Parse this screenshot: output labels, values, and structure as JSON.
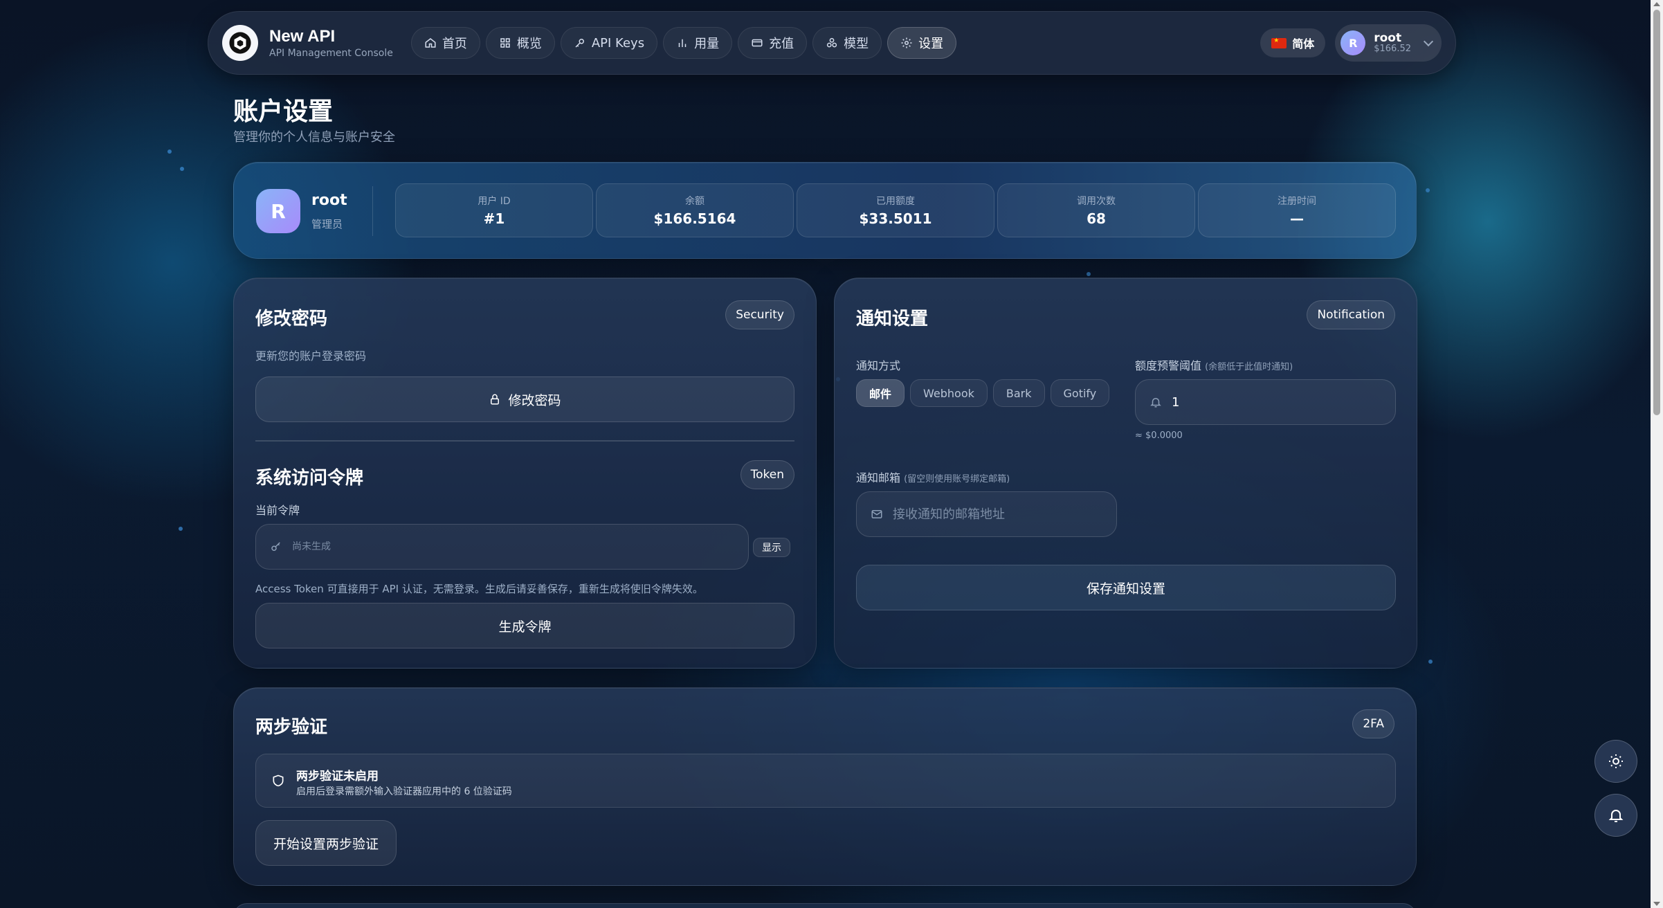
{
  "nav": {
    "brand_name": "New API",
    "brand_sub": "API Management Console",
    "items": [
      {
        "label": "首页",
        "icon": "home-icon"
      },
      {
        "label": "概览",
        "icon": "grid-icon"
      },
      {
        "label": "API Keys",
        "icon": "key-icon"
      },
      {
        "label": "用量",
        "icon": "bar-chart-icon"
      },
      {
        "label": "充值",
        "icon": "credit-card-icon"
      },
      {
        "label": "模型",
        "icon": "models-icon"
      },
      {
        "label": "设置",
        "icon": "gear-icon",
        "active": true
      }
    ],
    "language": "简体",
    "user": {
      "initial": "R",
      "name": "root",
      "balance": "$166.52"
    }
  },
  "page": {
    "title": "账户设置",
    "subtitle": "管理你的个人信息与账户安全"
  },
  "profile": {
    "initial": "R",
    "name": "root",
    "role": "管理员",
    "stats": [
      {
        "label": "用户 ID",
        "value": "#1"
      },
      {
        "label": "余额",
        "value": "$166.5164"
      },
      {
        "label": "已用额度",
        "value": "$33.5011"
      },
      {
        "label": "调用次数",
        "value": "68"
      },
      {
        "label": "注册时间",
        "value": "—"
      }
    ]
  },
  "password": {
    "title": "修改密码",
    "badge": "Security",
    "desc": "更新您的账户登录密码",
    "button": "修改密码"
  },
  "token": {
    "title": "系统访问令牌",
    "badge": "Token",
    "current_label": "当前令牌",
    "placeholder": "尚未生成",
    "show_label": "显示",
    "help": "Access Token 可直接用于 API 认证，无需登录。生成后请妥善保存，重新生成将使旧令牌失效。",
    "generate_button": "生成令牌"
  },
  "notify": {
    "title": "通知设置",
    "badge": "Notification",
    "method_label": "通知方式",
    "methods": [
      "邮件",
      "Webhook",
      "Bark",
      "Gotify"
    ],
    "active_method": "邮件",
    "threshold_label": "额度预警阈值",
    "threshold_hint": "(余额低于此值时通知)",
    "threshold_value": "1",
    "threshold_equiv": "≈ $0.0000",
    "email_label": "通知邮箱",
    "email_hint": "(留空则使用账号绑定邮箱)",
    "email_placeholder": "接收通知的邮箱地址",
    "save_button": "保存通知设置"
  },
  "twofa": {
    "title": "两步验证",
    "badge": "2FA",
    "status_title": "两步验证未启用",
    "status_desc": "启用后登录需额外输入验证器应用中的 6 位验证码",
    "setup_button": "开始设置两步验证"
  }
}
